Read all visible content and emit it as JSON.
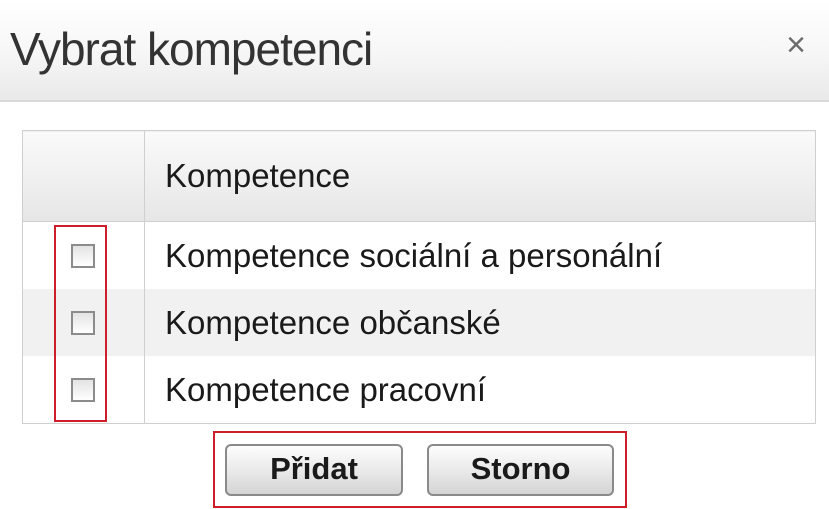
{
  "dialog": {
    "title": "Vybrat kompetenci",
    "close_label": "×"
  },
  "table": {
    "column_header": "Kompetence",
    "rows": [
      {
        "label": "Kompetence sociální a personální",
        "checked": false
      },
      {
        "label": "Kompetence občanské",
        "checked": false
      },
      {
        "label": "Kompetence pracovní",
        "checked": false
      }
    ]
  },
  "buttons": {
    "add_label": "Přidat",
    "cancel_label": "Storno"
  },
  "colors": {
    "highlight": "#cc1f2b",
    "row_alt": "#f1f1f1"
  }
}
